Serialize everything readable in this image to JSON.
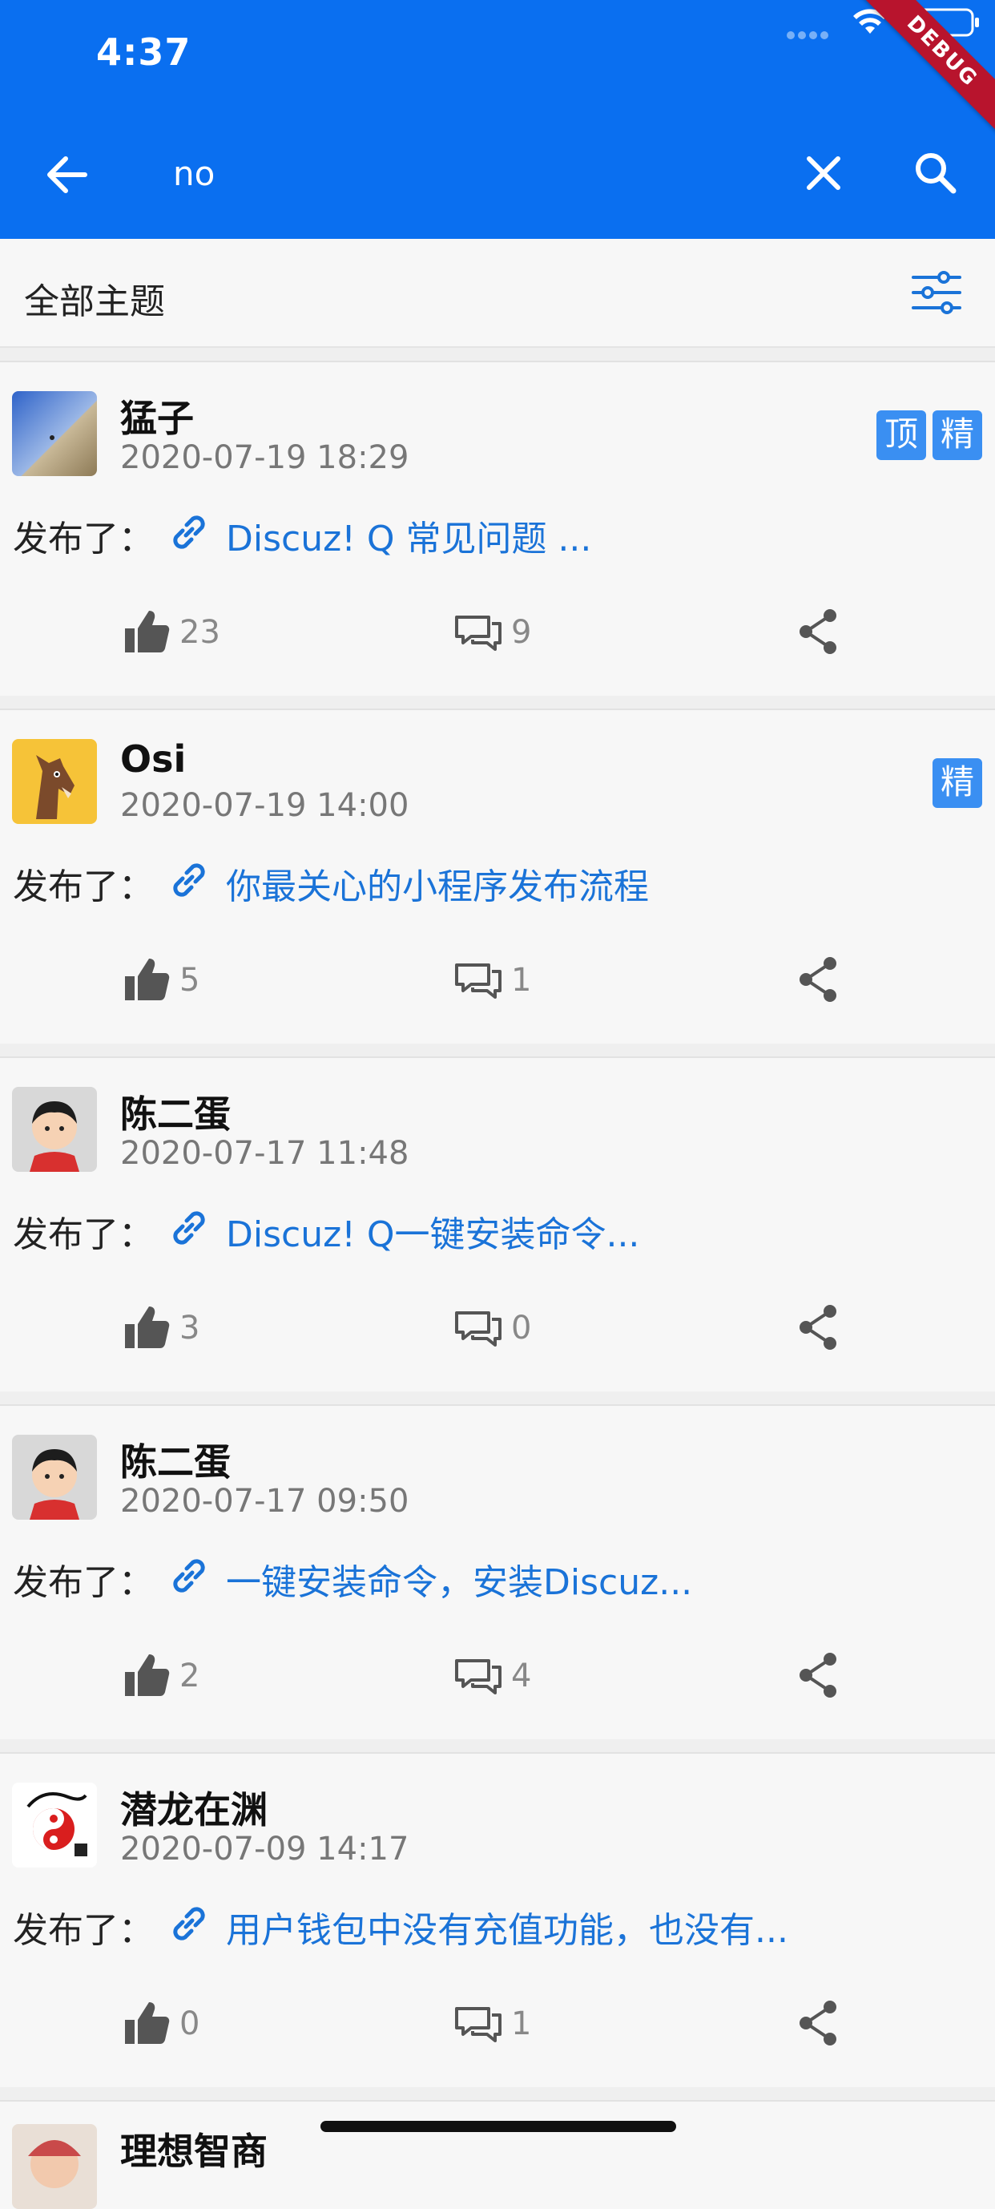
{
  "status_bar": {
    "time": "4:37",
    "debug_label": "DEBUG"
  },
  "search": {
    "value": "no"
  },
  "filter": {
    "title": "全部主题"
  },
  "colors": {
    "primary": "#0a6ff0",
    "link": "#1a73d8",
    "badge": "#3a8ff2",
    "debug": "#b8142d"
  },
  "posts": [
    {
      "author": "猛子",
      "time": "2020-07-19 18:29",
      "badges": [
        "顶",
        "精"
      ],
      "publish_label": "发布了：",
      "title": "Discuz! Q 常见问题 ...",
      "likes": "23",
      "comments": "9",
      "avatar_icon": "landscape-avatar"
    },
    {
      "author": "Osi",
      "time": "2020-07-19 14:00",
      "badges": [
        "精"
      ],
      "publish_label": "发布了：",
      "title": "你最关心的小程序发布流程",
      "likes": "5",
      "comments": "1",
      "avatar_icon": "horse-avatar"
    },
    {
      "author": "陈二蛋",
      "time": "2020-07-17 11:48",
      "badges": [],
      "publish_label": "发布了：",
      "title": "Discuz! Q一键安装命令...",
      "likes": "3",
      "comments": "0",
      "avatar_icon": "cartoon-boy-avatar"
    },
    {
      "author": "陈二蛋",
      "time": "2020-07-17 09:50",
      "badges": [],
      "publish_label": "发布了：",
      "title": "一键安装命令，安装Discuz...",
      "likes": "2",
      "comments": "4",
      "avatar_icon": "cartoon-boy-avatar"
    },
    {
      "author": "潜龙在渊",
      "time": "2020-07-09 14:17",
      "badges": [],
      "publish_label": "发布了：",
      "title": "用户钱包中没有充值功能，也没有...",
      "likes": "0",
      "comments": "1",
      "avatar_icon": "dragon-avatar"
    },
    {
      "author": "理想智商",
      "time": "",
      "badges": [],
      "publish_label": "",
      "title": "",
      "likes": "",
      "comments": "",
      "avatar_icon": "baby-avatar"
    }
  ]
}
